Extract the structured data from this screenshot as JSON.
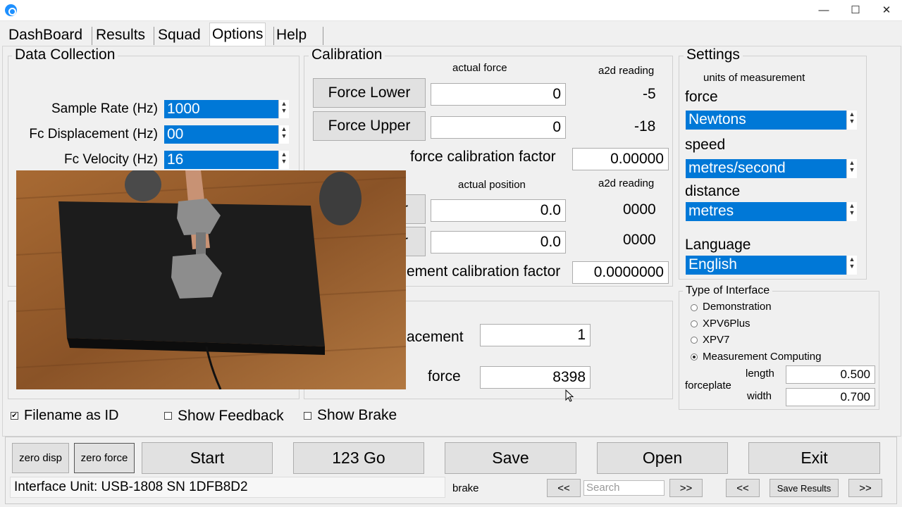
{
  "window": {
    "minimize_glyph": "—",
    "maximize_glyph": "☐",
    "close_glyph": "✕"
  },
  "tabs": [
    {
      "label": "DashBoard"
    },
    {
      "label": "Results"
    },
    {
      "label": "Squad"
    },
    {
      "label": "Options"
    },
    {
      "label": "Help"
    }
  ],
  "data_collection": {
    "title": "Data Collection",
    "sample_rate_label": "Sample Rate (Hz)",
    "sample_rate_value": "1000",
    "fc_disp_label": "Fc Displacement (Hz)",
    "fc_disp_value": "00",
    "fc_vel_label": "Fc Velocity (Hz)",
    "fc_vel_value": "16"
  },
  "calibration": {
    "title": "Calibration",
    "actual_force_header": "actual force",
    "a2d_header": "a2d reading",
    "force_lower_label": "Force Lower",
    "force_lower_value": "0",
    "force_lower_a2d": "-5",
    "force_upper_label": "Force Upper",
    "force_upper_value": "0",
    "force_upper_a2d": "-18",
    "force_factor_label": "force calibration factor",
    "force_factor_value": "0.00000",
    "actual_position_header": "actual position",
    "a2d_header_2": "a2d reading",
    "pos_lower_btn": "r",
    "pos_lower_value": "0.0",
    "pos_lower_a2d": "0000",
    "pos_upper_btn": "r",
    "pos_upper_value": "0.0",
    "pos_upper_a2d": "0000",
    "disp_factor_label": "ement calibration factor",
    "disp_factor_value": "0.0000000"
  },
  "live": {
    "displacement_label": "acement",
    "displacement_value": "1",
    "force_label": "force",
    "force_value": "8398"
  },
  "settings": {
    "title": "Settings",
    "units_header": "units of measurement",
    "force_label": "force",
    "force_value": "Newtons",
    "speed_label": "speed",
    "speed_value": "metres/second",
    "distance_label": "distance",
    "distance_value": "metres",
    "language_label": "Language",
    "language_value": "English"
  },
  "interface_type": {
    "title": "Type of Interface",
    "options": [
      {
        "label": "Demonstration",
        "selected": false
      },
      {
        "label": "XPV6Plus",
        "selected": false
      },
      {
        "label": "XPV7",
        "selected": false
      },
      {
        "label": "Measurement Computing",
        "selected": true
      }
    ],
    "forceplate_label": "forceplate",
    "length_label": "length",
    "length_value": "0.500",
    "width_label": "width",
    "width_value": "0.700"
  },
  "checkboxes": {
    "filename_label": "Filename as ID",
    "filename_checked": true,
    "feedback_label": "Show Feedback",
    "brake_label": "Show Brake"
  },
  "toolbar": {
    "zero_disp": "zero disp",
    "zero_force": "zero force",
    "start": "Start",
    "go": "123 Go",
    "save": "Save",
    "open": "Open",
    "exit": "Exit"
  },
  "statusbar": {
    "interface_unit": "Interface Unit: USB-1808 SN 1DFB8D2",
    "brake_label": "brake",
    "prev": "<<",
    "search_placeholder": "Search",
    "next": ">>",
    "prev2": "<<",
    "save_results": "Save Results",
    "next2": ">>"
  },
  "colors": {
    "selection": "#0078d7",
    "app_icon": "#1e90ff"
  }
}
